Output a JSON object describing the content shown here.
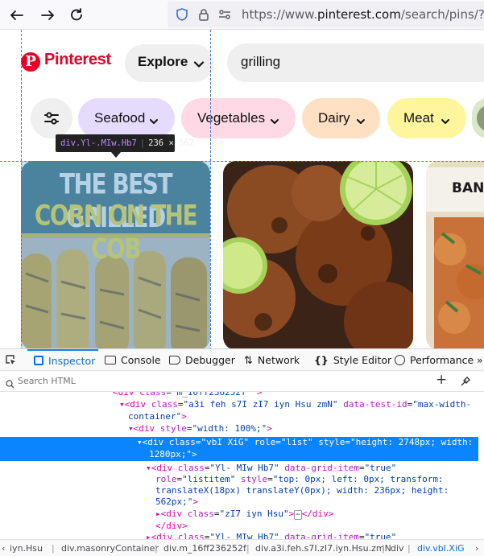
{
  "browser": {
    "url_prefix": "https://www.",
    "url_domain": "pinterest.com",
    "url_rest": "/search/pins/?q="
  },
  "header": {
    "logo_text": "Pinterest",
    "logo_glyph": "P",
    "explore_label": "Explore",
    "search_value": "grilling"
  },
  "filters": [
    {
      "label": "Seafood",
      "color": "#e5dbff"
    },
    {
      "label": "Vegetables",
      "color": "#ffd9e6"
    },
    {
      "label": "Dairy",
      "color": "#ffe0c2"
    },
    {
      "label": "Meat",
      "color": "#fff59c"
    }
  ],
  "inspector_tooltip": {
    "selector": "div.Yl-.MIw.Hb7",
    "size": "236 × 562"
  },
  "pins": [
    {
      "title_line1": "THE BEST GRILLED",
      "title_line2": "CORN ON THE COB"
    },
    {
      "alt": "grilled shrimp with lime"
    },
    {
      "title": "BANG"
    }
  ],
  "devtools": {
    "tabs": [
      "Inspector",
      "Console",
      "Debugger",
      "Network",
      "Style Editor",
      "Performance"
    ],
    "search_placeholder": "Search HTML",
    "breadcrumbs": [
      "iyn.Hsu",
      "div.masonryContainer",
      "div.m_16ff236252f",
      "div.a3i.feh.s7I.zI7.iyn.Hsu.zmN",
      "div",
      "div.vbI.XiG"
    ]
  }
}
